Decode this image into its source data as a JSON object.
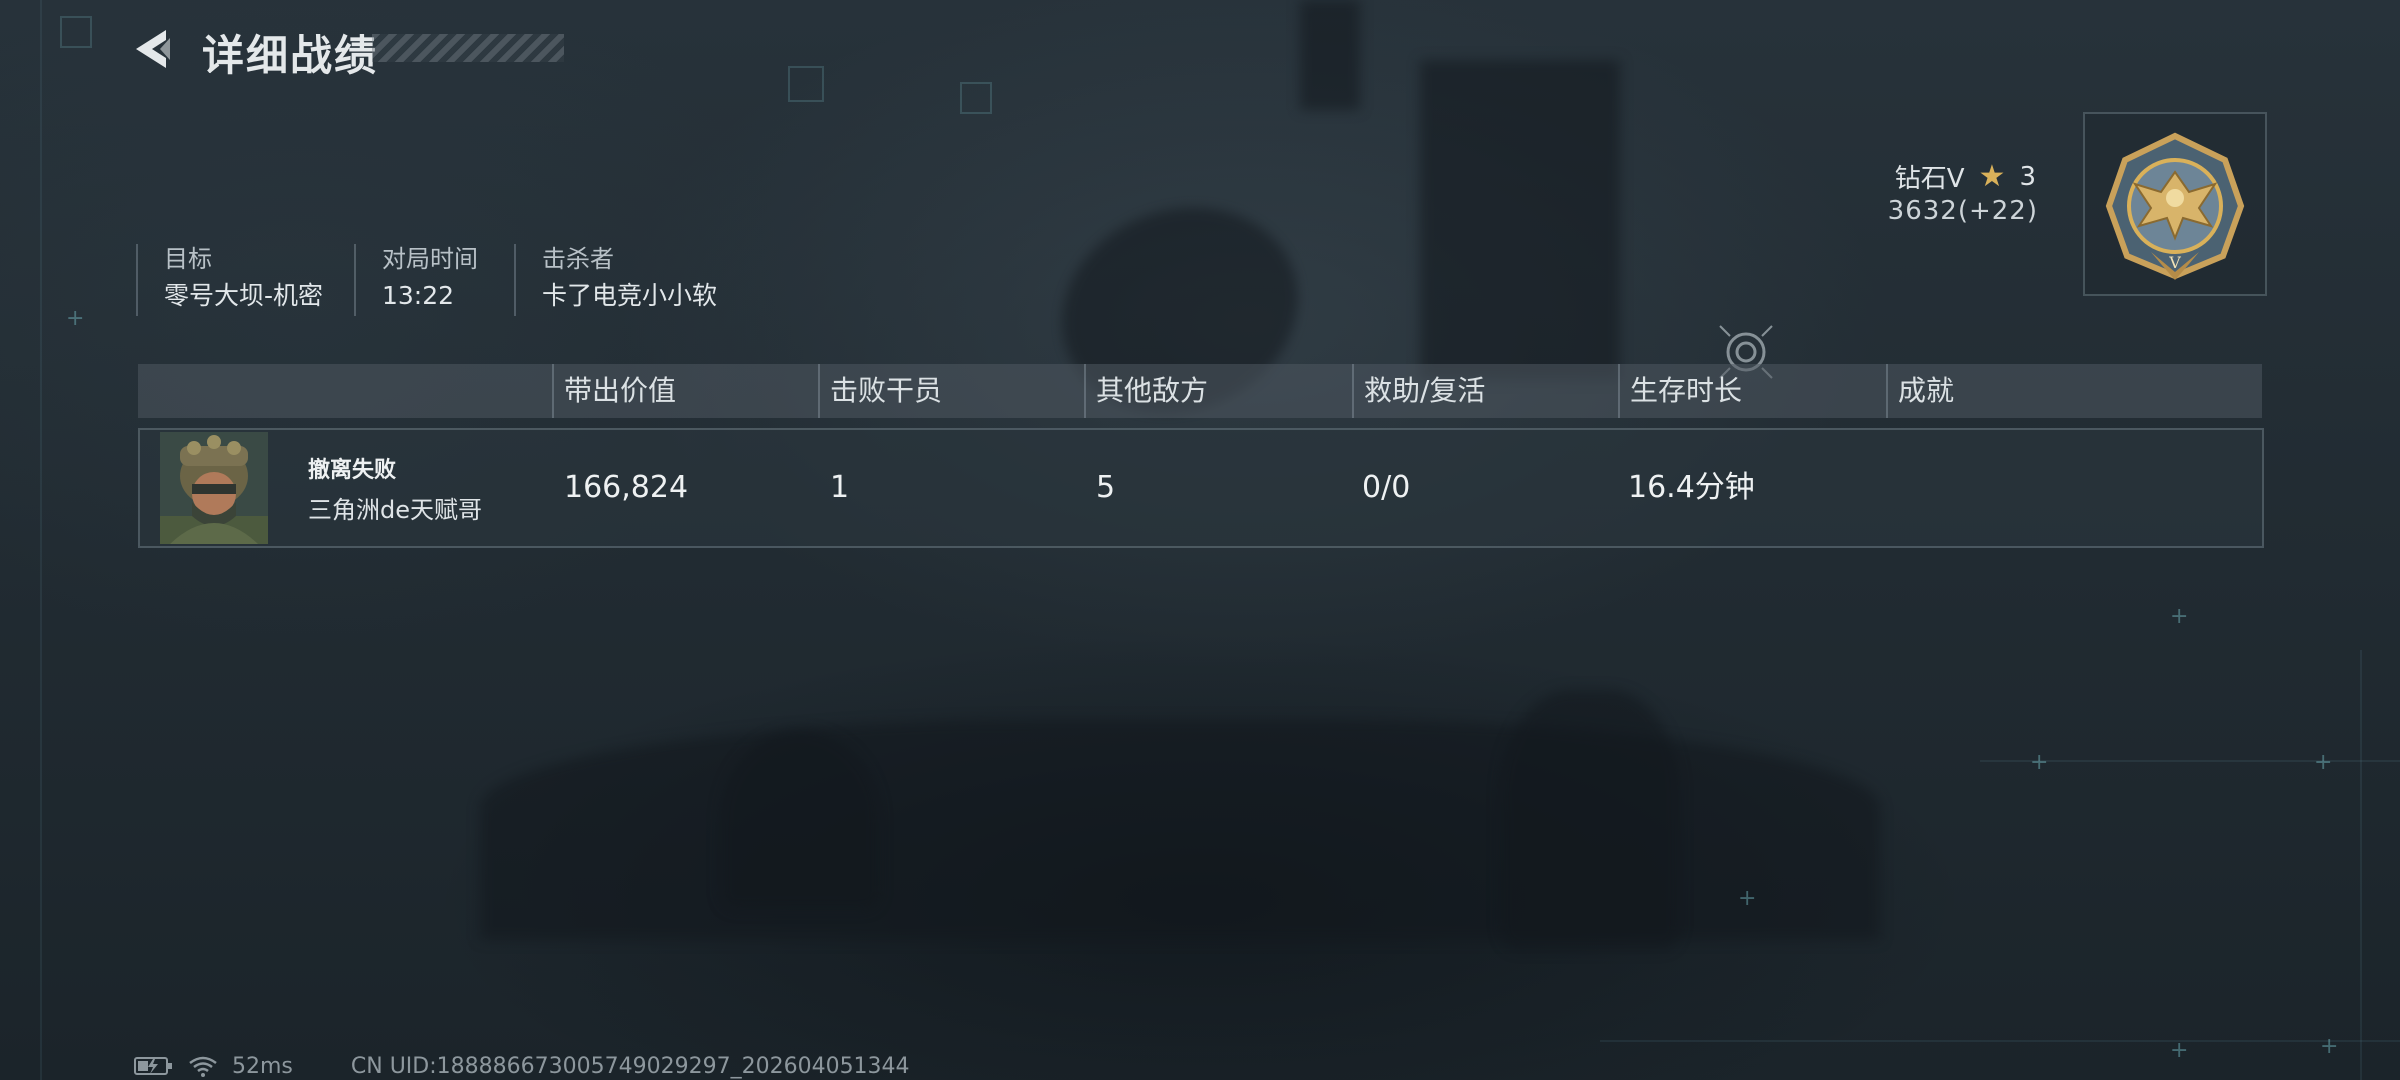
{
  "header": {
    "title": "详细战绩"
  },
  "info": {
    "target_label": "目标",
    "target_value": "零号大坝-机密",
    "duration_label": "对局时间",
    "duration_value": "13:22",
    "killer_label": "击杀者",
    "killer_value": "卡了电竞小小软"
  },
  "rank": {
    "name": "钻石V",
    "stars": "3",
    "score": "3632(+22)",
    "star_icon": "star-icon",
    "badge_icon": "eagle-medal-icon",
    "accent": "#d9b15a"
  },
  "table": {
    "headers": [
      "带出价值",
      "击败干员",
      "其他敌方",
      "救助/复活",
      "生存时长",
      "成就"
    ],
    "rows": [
      {
        "status": "撤离失败",
        "player": "三角洲de天赋哥",
        "value": "166,824",
        "operators_defeated": "1",
        "other_enemies": "5",
        "assist_revive": "0/0",
        "survival_time": "16.4分钟",
        "achievement": ""
      }
    ]
  },
  "footer": {
    "battery_icon": "battery-charging-icon",
    "wifi_icon": "wifi-icon",
    "ping": "52ms",
    "uid": "CN UID:18888667300574902929​7_202604051344"
  }
}
